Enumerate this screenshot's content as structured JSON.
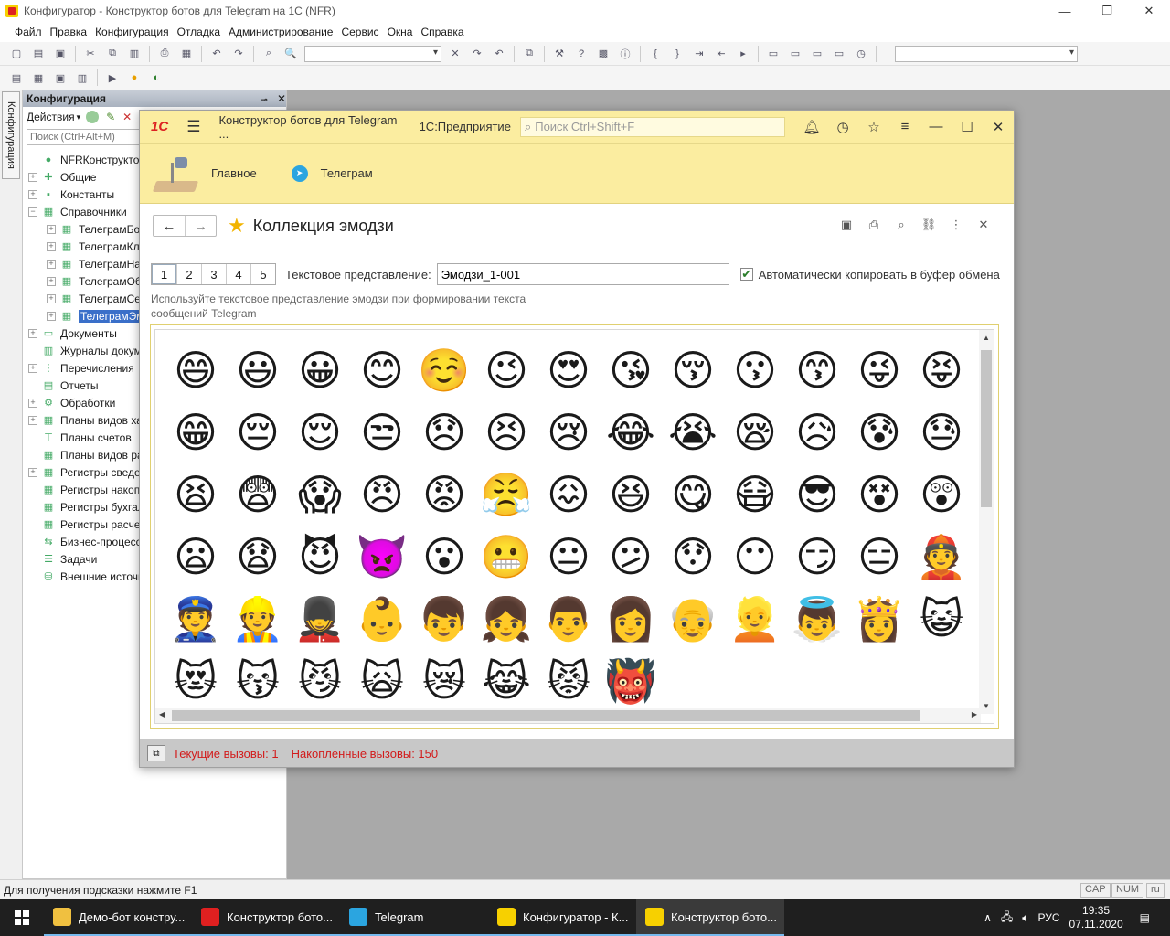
{
  "window": {
    "title": "Конфигуратор - Конструктор ботов для Telegram на 1С (NFR)"
  },
  "menu": [
    "Файл",
    "Правка",
    "Конфигурация",
    "Отладка",
    "Администрирование",
    "Сервис",
    "Окна",
    "Справка"
  ],
  "config_panel": {
    "title": "Конфигурация",
    "actions_label": "Действия",
    "search_placeholder": "Поиск (Ctrl+Alt+M)",
    "side_tab": "Конфигурация",
    "tree": [
      {
        "label": "NFRКонструкторБот",
        "level": 0,
        "exp": "",
        "icon": "config-icon"
      },
      {
        "label": "Общие",
        "level": 0,
        "exp": "+",
        "icon": "common-icon"
      },
      {
        "label": "Константы",
        "level": 0,
        "exp": "+",
        "icon": "constants-icon"
      },
      {
        "label": "Справочники",
        "level": 0,
        "exp": "−",
        "icon": "catalog-icon"
      },
      {
        "label": "ТелеграмБо",
        "level": 1,
        "exp": "+",
        "icon": "catalog-icon"
      },
      {
        "label": "ТелеграмКл",
        "level": 1,
        "exp": "+",
        "icon": "catalog-icon"
      },
      {
        "label": "ТелеграмНа",
        "level": 1,
        "exp": "+",
        "icon": "catalog-icon"
      },
      {
        "label": "ТелеграмОб",
        "level": 1,
        "exp": "+",
        "icon": "catalog-icon"
      },
      {
        "label": "ТелеграмСе",
        "level": 1,
        "exp": "+",
        "icon": "catalog-icon"
      },
      {
        "label": "ТелеграмЭм",
        "level": 1,
        "exp": "+",
        "icon": "catalog-icon",
        "selected": true
      },
      {
        "label": "Документы",
        "level": 0,
        "exp": "+",
        "icon": "document-icon"
      },
      {
        "label": "Журналы докум",
        "level": 0,
        "exp": "",
        "icon": "journal-icon"
      },
      {
        "label": "Перечисления",
        "level": 0,
        "exp": "+",
        "icon": "enum-icon"
      },
      {
        "label": "Отчеты",
        "level": 0,
        "exp": "",
        "icon": "report-icon"
      },
      {
        "label": "Обработки",
        "level": 0,
        "exp": "+",
        "icon": "processing-icon"
      },
      {
        "label": "Планы видов хар",
        "level": 0,
        "exp": "+",
        "icon": "plan-icon"
      },
      {
        "label": "Планы счетов",
        "level": 0,
        "exp": "",
        "icon": "accounts-icon"
      },
      {
        "label": "Планы видов ра",
        "level": 0,
        "exp": "",
        "icon": "plan-icon"
      },
      {
        "label": "Регистры сведе",
        "level": 0,
        "exp": "+",
        "icon": "register-icon"
      },
      {
        "label": "Регистры накоп",
        "level": 0,
        "exp": "",
        "icon": "register-icon"
      },
      {
        "label": "Регистры бухгал",
        "level": 0,
        "exp": "",
        "icon": "register-icon"
      },
      {
        "label": "Регистры расчет",
        "level": 0,
        "exp": "",
        "icon": "register-icon"
      },
      {
        "label": "Бизнес-процесс",
        "level": 0,
        "exp": "",
        "icon": "process-icon"
      },
      {
        "label": "Задачи",
        "level": 0,
        "exp": "",
        "icon": "task-icon"
      },
      {
        "label": "Внешние источн",
        "level": 0,
        "exp": "",
        "icon": "external-icon"
      }
    ]
  },
  "app": {
    "logo": "1С",
    "title": "Конструктор ботов для Telegram ...",
    "platform": "1С:Предприятие",
    "search_placeholder": "Поиск Ctrl+Shift+F",
    "sections": [
      "Главное",
      "Телеграм"
    ]
  },
  "form": {
    "title": "Коллекция эмодзи",
    "pages": [
      "1",
      "2",
      "3",
      "4",
      "5"
    ],
    "text_repr_label": "Текстовое представление:",
    "text_repr_value": "Эмодзи_1-001",
    "auto_copy_label": "Автоматически копировать в буфер обмена",
    "auto_copy_checked": true,
    "hint": "Используйте текстовое представление эмодзи при формировании текста сообщений Telegram"
  },
  "emoji_rows": [
    [
      "😄",
      "😃",
      "😀",
      "😊",
      "☺️",
      "😉",
      "😍",
      "😘",
      "😚",
      "😗",
      "😙",
      "😜",
      "😝"
    ],
    [
      "😳",
      "😁",
      "😔",
      "😌",
      "😒",
      "😞",
      "😣",
      "😢",
      "😂",
      "😭",
      "😪",
      "😥",
      "😰"
    ],
    [
      "😓",
      "😩",
      "😫",
      "😨",
      "😱",
      "😠",
      "😡",
      "😤",
      "😖",
      "😆",
      "😋",
      "😷",
      "😎"
    ],
    [
      "😵",
      "😲",
      "😟",
      "😦",
      "😧",
      "😈",
      "👿",
      "😮",
      "😬",
      "😐",
      "😕",
      "😯",
      "😶"
    ],
    [
      "😏",
      "😑",
      "👲",
      "👳",
      "👮",
      "👷",
      "💂",
      "👶",
      "👦",
      "👧",
      "👨",
      "👩",
      "👴"
    ],
    [
      "👱",
      "👼",
      "👸",
      "😺",
      "😸",
      "😻",
      "😽",
      "😼",
      "🙀",
      "😿",
      "😹",
      "😾",
      "👹"
    ]
  ],
  "status": {
    "current_calls": "Текущие вызовы: 1",
    "accumulated_calls": "Накопленные вызовы: 150",
    "hint": "Для получения подсказки нажмите F1",
    "cap": "CAP",
    "num": "NUM",
    "lang": "ru"
  },
  "taskbar": {
    "items": [
      {
        "label": "Демо-бот констру...",
        "color": "#f0c040",
        "icon": "folder-icon"
      },
      {
        "label": "Конструктор бото...",
        "color": "#e02020",
        "icon": "opera-icon"
      },
      {
        "label": "Telegram",
        "color": "#2ba5e0",
        "icon": "telegram-icon"
      },
      {
        "label": "Конфигуратор - К...",
        "color": "#f7d000",
        "icon": "configurator-icon"
      },
      {
        "label": "Конструктор бото...",
        "color": "#f7d000",
        "icon": "enterprise-icon",
        "active": true
      }
    ],
    "lang": "РУС",
    "time": "19:35",
    "date": "07.11.2020"
  }
}
